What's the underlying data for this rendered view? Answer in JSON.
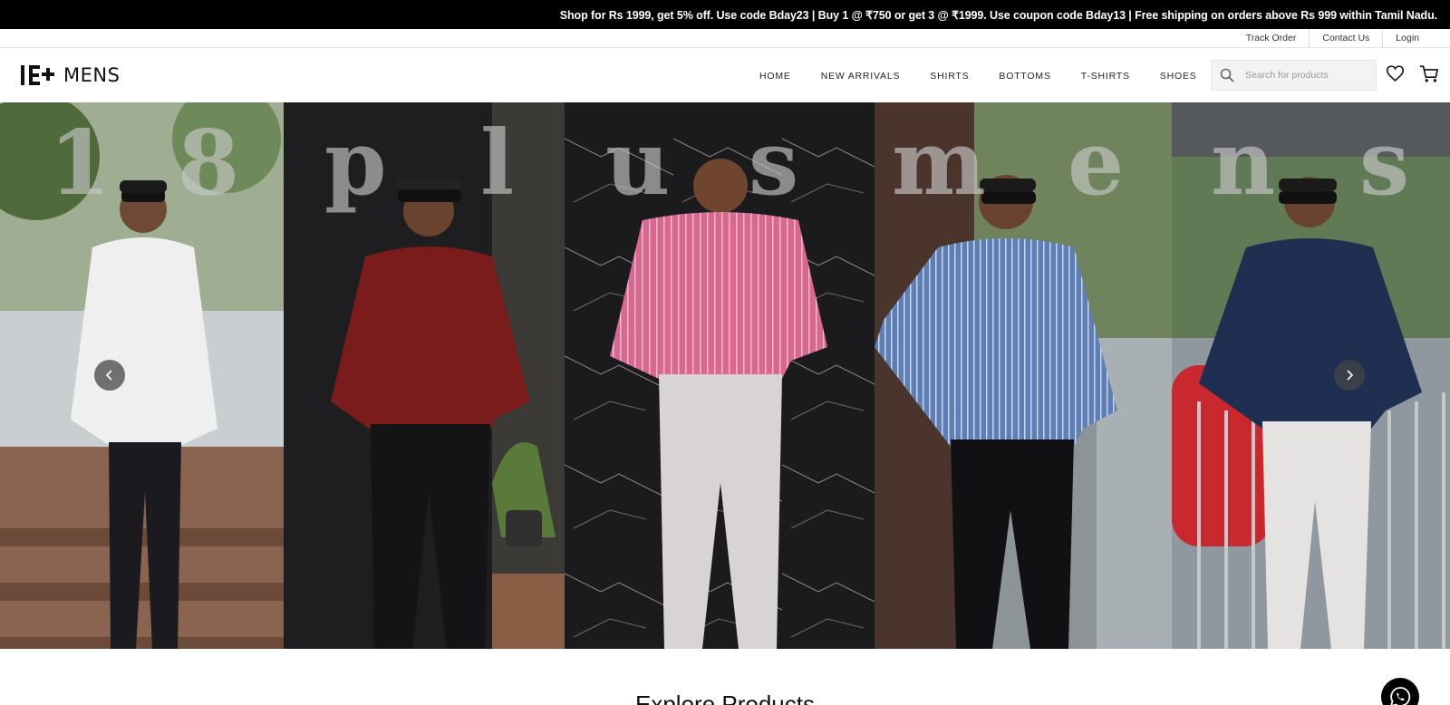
{
  "promo": {
    "text": "Shop for Rs 1999, get 5% off. Use code Bday23 | Buy 1 @ ₹750 or get 3 @ ₹1999. Use coupon code Bday13 | Free shipping on orders above Rs 999 within Tamil Nadu."
  },
  "utility_links": {
    "track_order": "Track Order",
    "contact_us": "Contact Us",
    "login": "Login"
  },
  "logo": {
    "mark": "18+",
    "text": "MENS"
  },
  "nav": {
    "items": [
      "HOME",
      "NEW ARRIVALS",
      "SHIRTS",
      "BOTTOMS",
      "T-SHIRTS",
      "SHOES"
    ]
  },
  "search": {
    "placeholder": "Search for products",
    "value": ""
  },
  "icons": {
    "search": "search-icon",
    "wishlist": "heart-icon",
    "cart": "cart-icon",
    "prev": "chevron-left-icon",
    "next": "chevron-right-icon",
    "whatsapp": "whatsapp-icon"
  },
  "hero": {
    "wordmark_letters": [
      "1",
      "8",
      "p",
      "l",
      "u",
      "s",
      "m",
      "e",
      "n",
      "s"
    ],
    "panels": [
      {
        "shirt": "white shirt",
        "shirt_color": "#efefef",
        "pants_color": "#1b1b1f",
        "bg_color": "#8a9a7f"
      },
      {
        "shirt": "maroon shirt",
        "shirt_color": "#7a1b1c",
        "pants_color": "#141416",
        "bg_color": "#222222"
      },
      {
        "shirt": "pink striped shirt",
        "shirt_color": "#d9688f",
        "pants_color": "#d8d4d6",
        "bg_color": "#1c1c1e"
      },
      {
        "shirt": "blue striped shirt",
        "shirt_color": "#5e7fb6",
        "pants_color": "#111114",
        "bg_color": "#4a3b35"
      },
      {
        "shirt": "navy shirt",
        "shirt_color": "#1f2f52",
        "pants_color": "#e5e3e1",
        "bg_color": "#6d7780"
      }
    ]
  },
  "section": {
    "featured_title": "Explore Products"
  }
}
